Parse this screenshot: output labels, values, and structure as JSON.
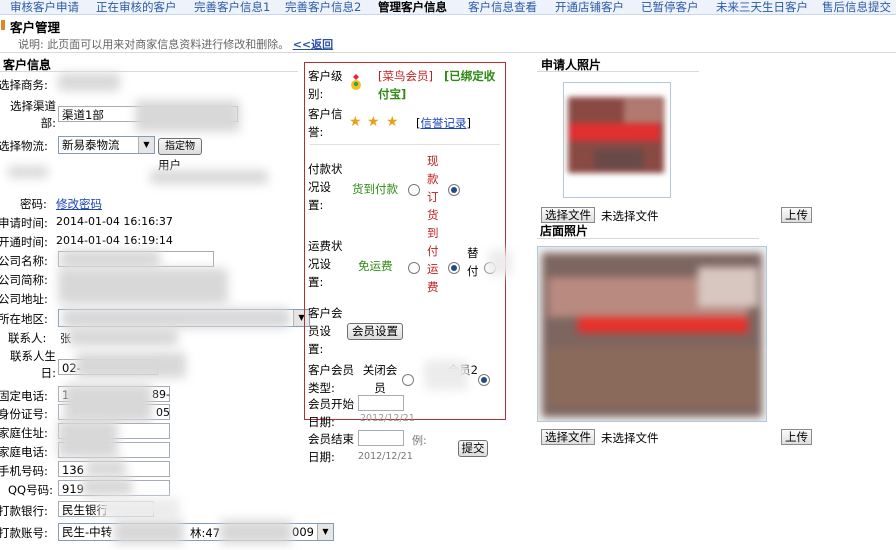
{
  "nav": {
    "tabs": [
      "审核客户申请",
      "正在审核的客户",
      "完善客户信息1",
      "完善客户信息2",
      "管理客户信息",
      "客户信息查看",
      "开通店铺客户",
      "已暂停客户",
      "未来三天生日客户",
      "售后信息提交"
    ],
    "active_index": 4
  },
  "header": {
    "title": "客户管理",
    "description": "说明: 此页面可以用来对商家信息资料进行修改和删除。",
    "back_label": "<<返回"
  },
  "customer_info": {
    "section_title": "客户信息",
    "labels": {
      "business": "选择商务:",
      "channel": "选择渠道部:",
      "logistics": "选择物流:",
      "user": "用户",
      "password": "密码:",
      "apply_time": "申请时间:",
      "open_time": "开通时间:",
      "company_name": "公司名称:",
      "company_short": "公司简称:",
      "company_address": "公司地址:",
      "region": "所在地区:",
      "contact": "联系人:",
      "contact_birthday": "联系人生日:",
      "phone": "固定电话:",
      "id_number": "身份证号:",
      "home_address": "家庭住址:",
      "home_phone": "家庭电话:",
      "mobile": "手机号码:",
      "qq": "QQ号码:",
      "bank": "打款银行:",
      "account": "打款账号:"
    },
    "channel_value": "渠道1部",
    "logistics_value": "新易泰物流",
    "logistics_button": "指定物",
    "password_link": "修改密码",
    "apply_time": "2014-01-04 16:16:37",
    "open_time": "2014-01-04 16:19:14",
    "contact_value": "张",
    "birthday_value": "02-",
    "phone_value": "1",
    "phone_tail": "89-",
    "id_tail": "05",
    "mobile_value": "136",
    "qq_value": "919",
    "bank_value": "民生银行",
    "account_value": "民生-中转",
    "account_mid": "林:47",
    "account_tail": "009"
  },
  "member_panel": {
    "level_label": "客户级别:",
    "level_value": "[菜鸟会员]",
    "bound_value": "[已绑定收付宝]",
    "credit_label": "客户信誉:",
    "stars": 3,
    "credit_link": "信誉记录",
    "payment_label": "付款状况设置:",
    "payment_opt1": "货到付款",
    "payment_opt2": "现款订货到付运费",
    "payment_selected": 2,
    "freight_label": "运费状况设置:",
    "freight_opt1": "免运费",
    "freight_opt2": "替付",
    "freight_selected": 1,
    "member_set_label": "客户会员设置:",
    "member_set_button": "会员设置",
    "member_type_label": "客户会员类型:",
    "member_type_opt1": "关闭会员",
    "member_type_opt2": "会员2",
    "start_label": "会员开始日期:",
    "start_example": "2012/12/21",
    "end_label": "会员结束日期:",
    "end_example_prefix": "例:",
    "end_example": "2012/12/21",
    "submit_label": "提交"
  },
  "photos": {
    "applicant_title": "申请人照片",
    "store_title": "店面照片",
    "choose_file": "选择文件",
    "no_file": "未选择文件",
    "upload": "上传"
  },
  "colors": {
    "nav_bg": "#eef3fb",
    "link": "#1a44b8",
    "panel_border": "#b23030",
    "green": "#2e8a14",
    "red": "#c02020",
    "star": "#e8a21a"
  }
}
